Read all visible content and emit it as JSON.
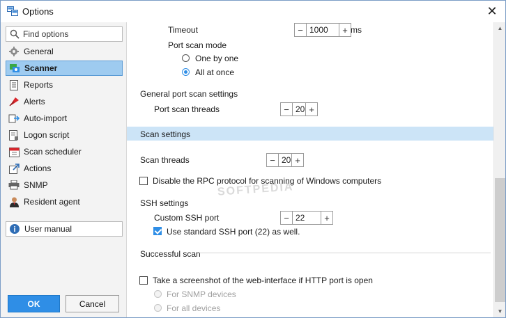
{
  "window": {
    "title": "Options",
    "close_glyph": "✕"
  },
  "sidebar": {
    "search_placeholder": "Find options",
    "items": [
      {
        "label": "General",
        "icon": "gear-icon",
        "active": false
      },
      {
        "label": "Scanner",
        "icon": "scanner-icon",
        "active": true
      },
      {
        "label": "Reports",
        "icon": "report-icon",
        "active": false
      },
      {
        "label": "Alerts",
        "icon": "alert-flag-icon",
        "active": false
      },
      {
        "label": "Auto-import",
        "icon": "auto-import-icon",
        "active": false
      },
      {
        "label": "Logon script",
        "icon": "script-icon",
        "active": false
      },
      {
        "label": "Scan scheduler",
        "icon": "calendar-icon",
        "active": false
      },
      {
        "label": "Actions",
        "icon": "actions-icon",
        "active": false
      },
      {
        "label": "SNMP",
        "icon": "printer-icon",
        "active": false
      },
      {
        "label": "Resident agent",
        "icon": "agent-icon",
        "active": false
      }
    ],
    "manual_label": "User manual"
  },
  "buttons": {
    "ok": "OK",
    "cancel": "Cancel"
  },
  "content": {
    "timeout_label": "Timeout",
    "timeout_value": "1000",
    "timeout_unit": "ms",
    "port_scan_mode_label": "Port scan mode",
    "mode_one_by_one": "One by one",
    "mode_all_at_once": "All at once",
    "general_port_scan_label": "General port scan settings",
    "port_scan_threads_label": "Port scan threads",
    "port_scan_threads_value": "20",
    "scan_settings_header": "Scan settings",
    "scan_threads_label": "Scan threads",
    "scan_threads_value": "20",
    "disable_rpc_label": "Disable the RPC protocol for scanning of Windows computers",
    "ssh_settings_label": "SSH settings",
    "custom_ssh_port_label": "Custom SSH port",
    "custom_ssh_port_value": "22",
    "use_standard_ssh_label": "Use standard SSH port (22) as well.",
    "successful_scan_label": "Successful scan",
    "screenshot_label": "Take a screenshot of the web-interface if HTTP port is open",
    "snmp_devices_label": "For SNMP devices",
    "all_devices_label": "For all devices",
    "minus_glyph": "−",
    "plus_glyph": "+"
  },
  "watermark": "SOFTPEDIA",
  "colors": {
    "accent": "#2f8ee6",
    "selection": "#9ecbf0",
    "section_band": "#cce4f7"
  }
}
